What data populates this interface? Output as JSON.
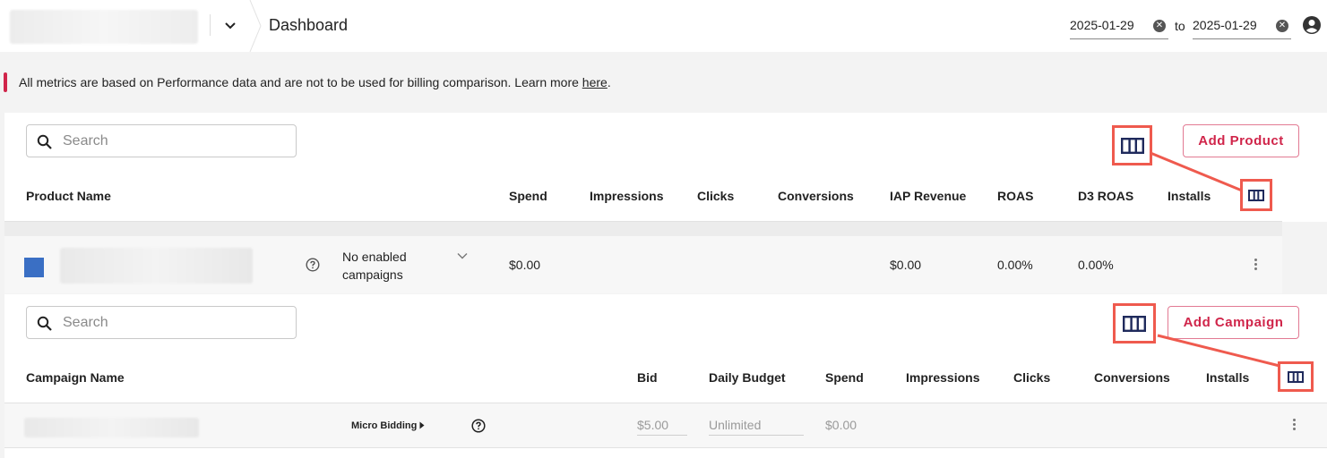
{
  "header": {
    "page_title": "Dashboard",
    "date_from": "2025-01-29",
    "date_to": "2025-01-29",
    "to_label": "to"
  },
  "notice": {
    "text": "All metrics are based on Performance data and are not to be used for billing comparison. Learn more ",
    "link": "here",
    "suffix": "."
  },
  "product_panel": {
    "search_placeholder": "Search",
    "add_button": "Add Product",
    "columns": [
      "Product Name",
      "Spend",
      "Impressions",
      "Clicks",
      "Conversions",
      "IAP Revenue",
      "ROAS",
      "D3 ROAS",
      "Installs"
    ],
    "row": {
      "color": "#3a6fc4",
      "campaigns_status": "No enabled campaigns",
      "spend": "$0.00",
      "iap_revenue": "$0.00",
      "roas": "0.00%",
      "d3_roas": "0.00%"
    }
  },
  "campaign_panel": {
    "search_placeholder": "Search",
    "add_button": "Add Campaign",
    "columns": [
      "Campaign Name",
      "Bid",
      "Daily Budget",
      "Spend",
      "Impressions",
      "Clicks",
      "Conversions",
      "Installs"
    ],
    "row": {
      "bidding_type": "Micro Bidding",
      "bid": "$5.00",
      "daily_budget": "Unlimited",
      "spend": "$0.00"
    }
  },
  "colors": {
    "accent": "#d0254a",
    "highlight": "#ef5a4e",
    "icon": "#1f2a5c"
  },
  "icons": [
    "chevron-down-icon",
    "account-icon",
    "clear-icon",
    "search-icon",
    "columns-icon",
    "help-icon",
    "kebab-icon",
    "caret-right-icon"
  ]
}
